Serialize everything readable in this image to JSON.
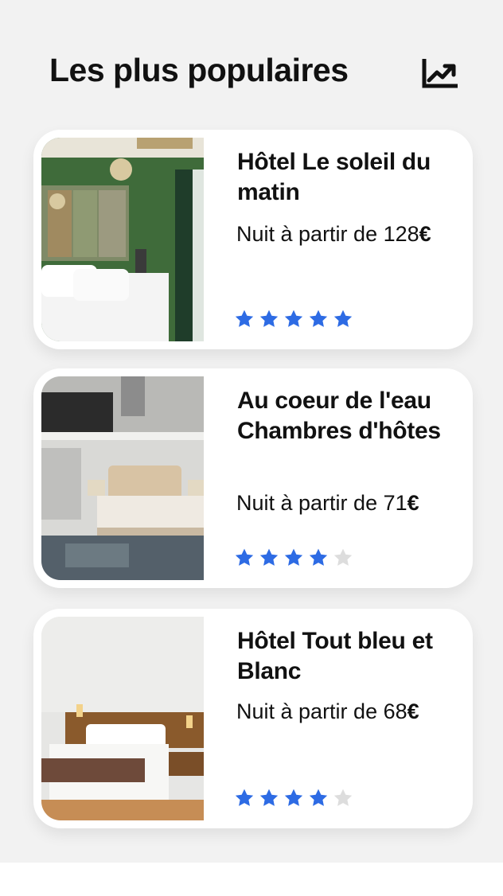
{
  "header": {
    "title": "Les plus populaires",
    "icon": "trending-up-icon"
  },
  "colors": {
    "star_filled": "#2d6be4",
    "star_empty": "#dddddd",
    "background": "#f2f2f2"
  },
  "hotels": [
    {
      "name": "Hôtel Le soleil du matin",
      "price_label": "Nuit à partir de",
      "price": "128",
      "currency": "€",
      "rating": 5,
      "max_rating": 5
    },
    {
      "name": "Au coeur de l'eau Chambres d'hôtes",
      "price_label": "Nuit à partir de",
      "price": "71",
      "currency": "€",
      "rating": 4,
      "max_rating": 5
    },
    {
      "name": "Hôtel Tout bleu et Blanc",
      "price_label": "Nuit à partir de",
      "price": "68",
      "currency": "€",
      "rating": 4,
      "max_rating": 5
    }
  ]
}
